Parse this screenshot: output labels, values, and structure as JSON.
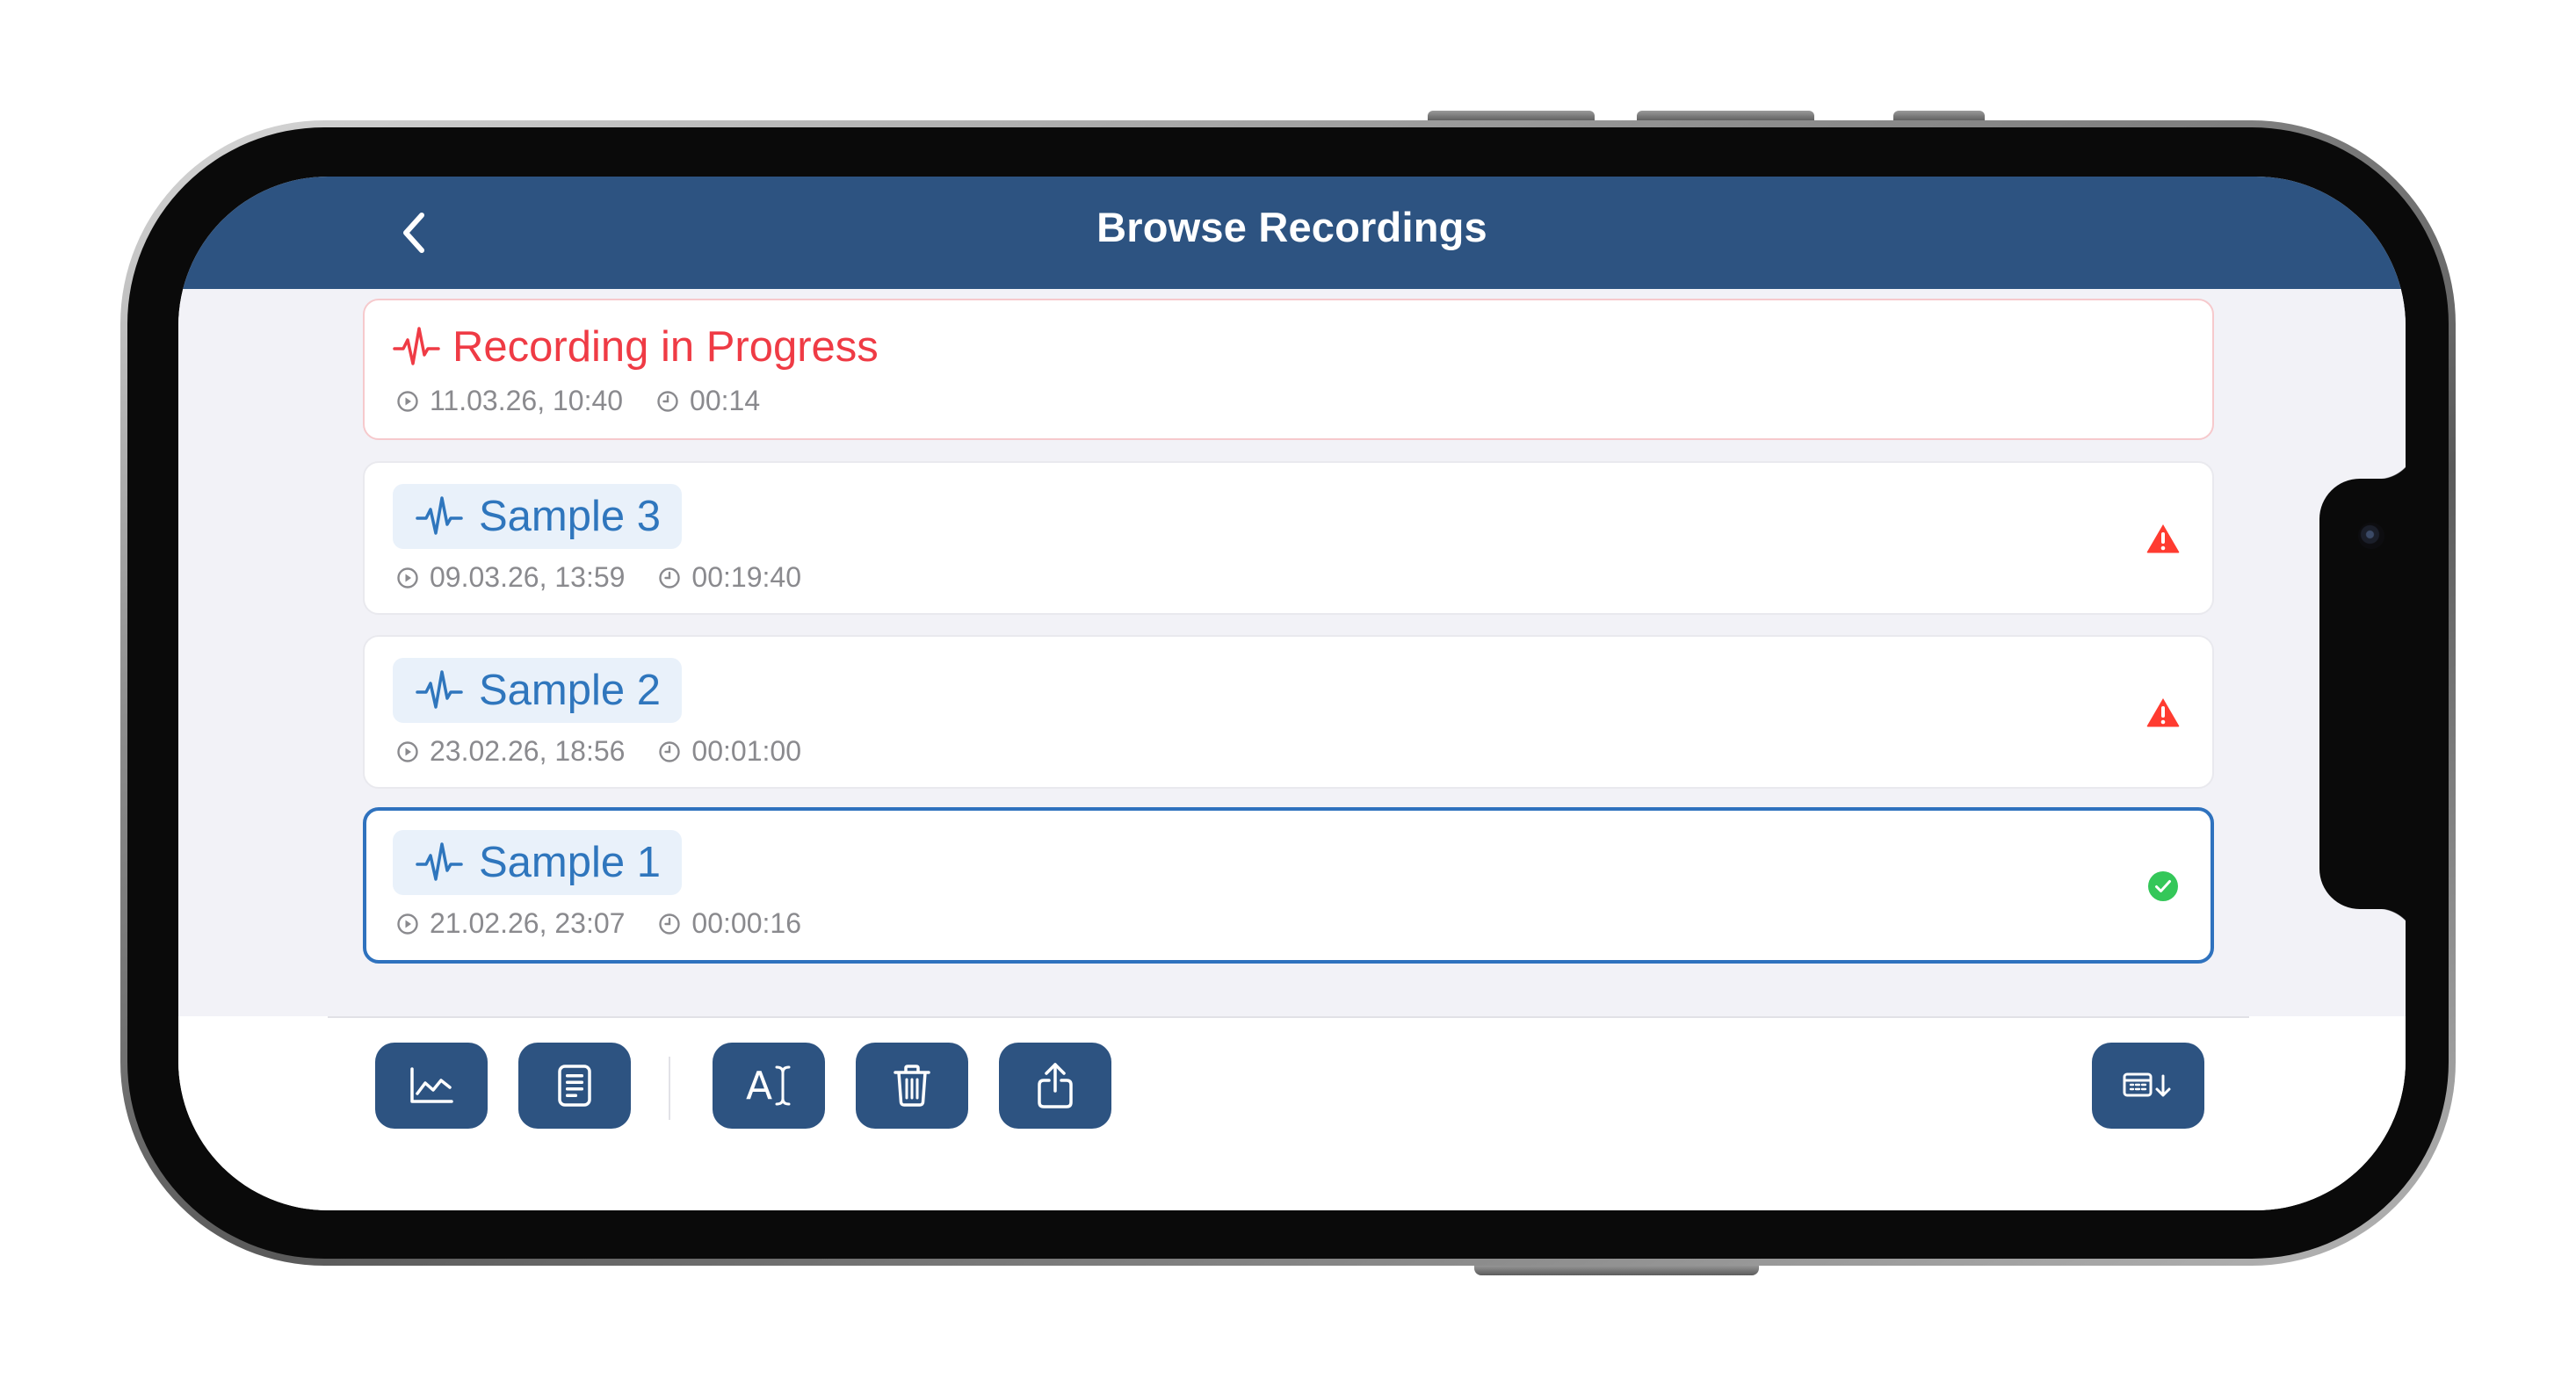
{
  "nav": {
    "title": "Browse Recordings",
    "back_icon": "chevron-left-icon"
  },
  "recordings": [
    {
      "title": "Recording in Progress",
      "date": "11.03.26, 10:40",
      "duration": "00:14",
      "state": "in-progress",
      "status_icon": "none"
    },
    {
      "title": "Sample 3",
      "date": "09.03.26, 13:59",
      "duration": "00:19:40",
      "state": "normal",
      "status_icon": "warning-icon"
    },
    {
      "title": "Sample 2",
      "date": "23.02.26, 18:56",
      "duration": "00:01:00",
      "state": "normal",
      "status_icon": "warning-icon"
    },
    {
      "title": "Sample 1",
      "date": "21.02.26, 23:07",
      "duration": "00:00:16",
      "state": "selected",
      "status_icon": "check-circle-icon"
    }
  ],
  "toolbar": {
    "buttons": [
      "chart-icon",
      "document-icon",
      "rename-icon",
      "trash-icon",
      "share-icon",
      "export-table-icon"
    ],
    "rename_label": "A"
  },
  "colors": {
    "nav_bar": "#2d5381",
    "accent_blue": "#2f76bd",
    "recording_red": "#ef3b45",
    "warning_red": "#ff3b30",
    "success_green": "#34c759",
    "content_bg": "#f2f2f7"
  }
}
